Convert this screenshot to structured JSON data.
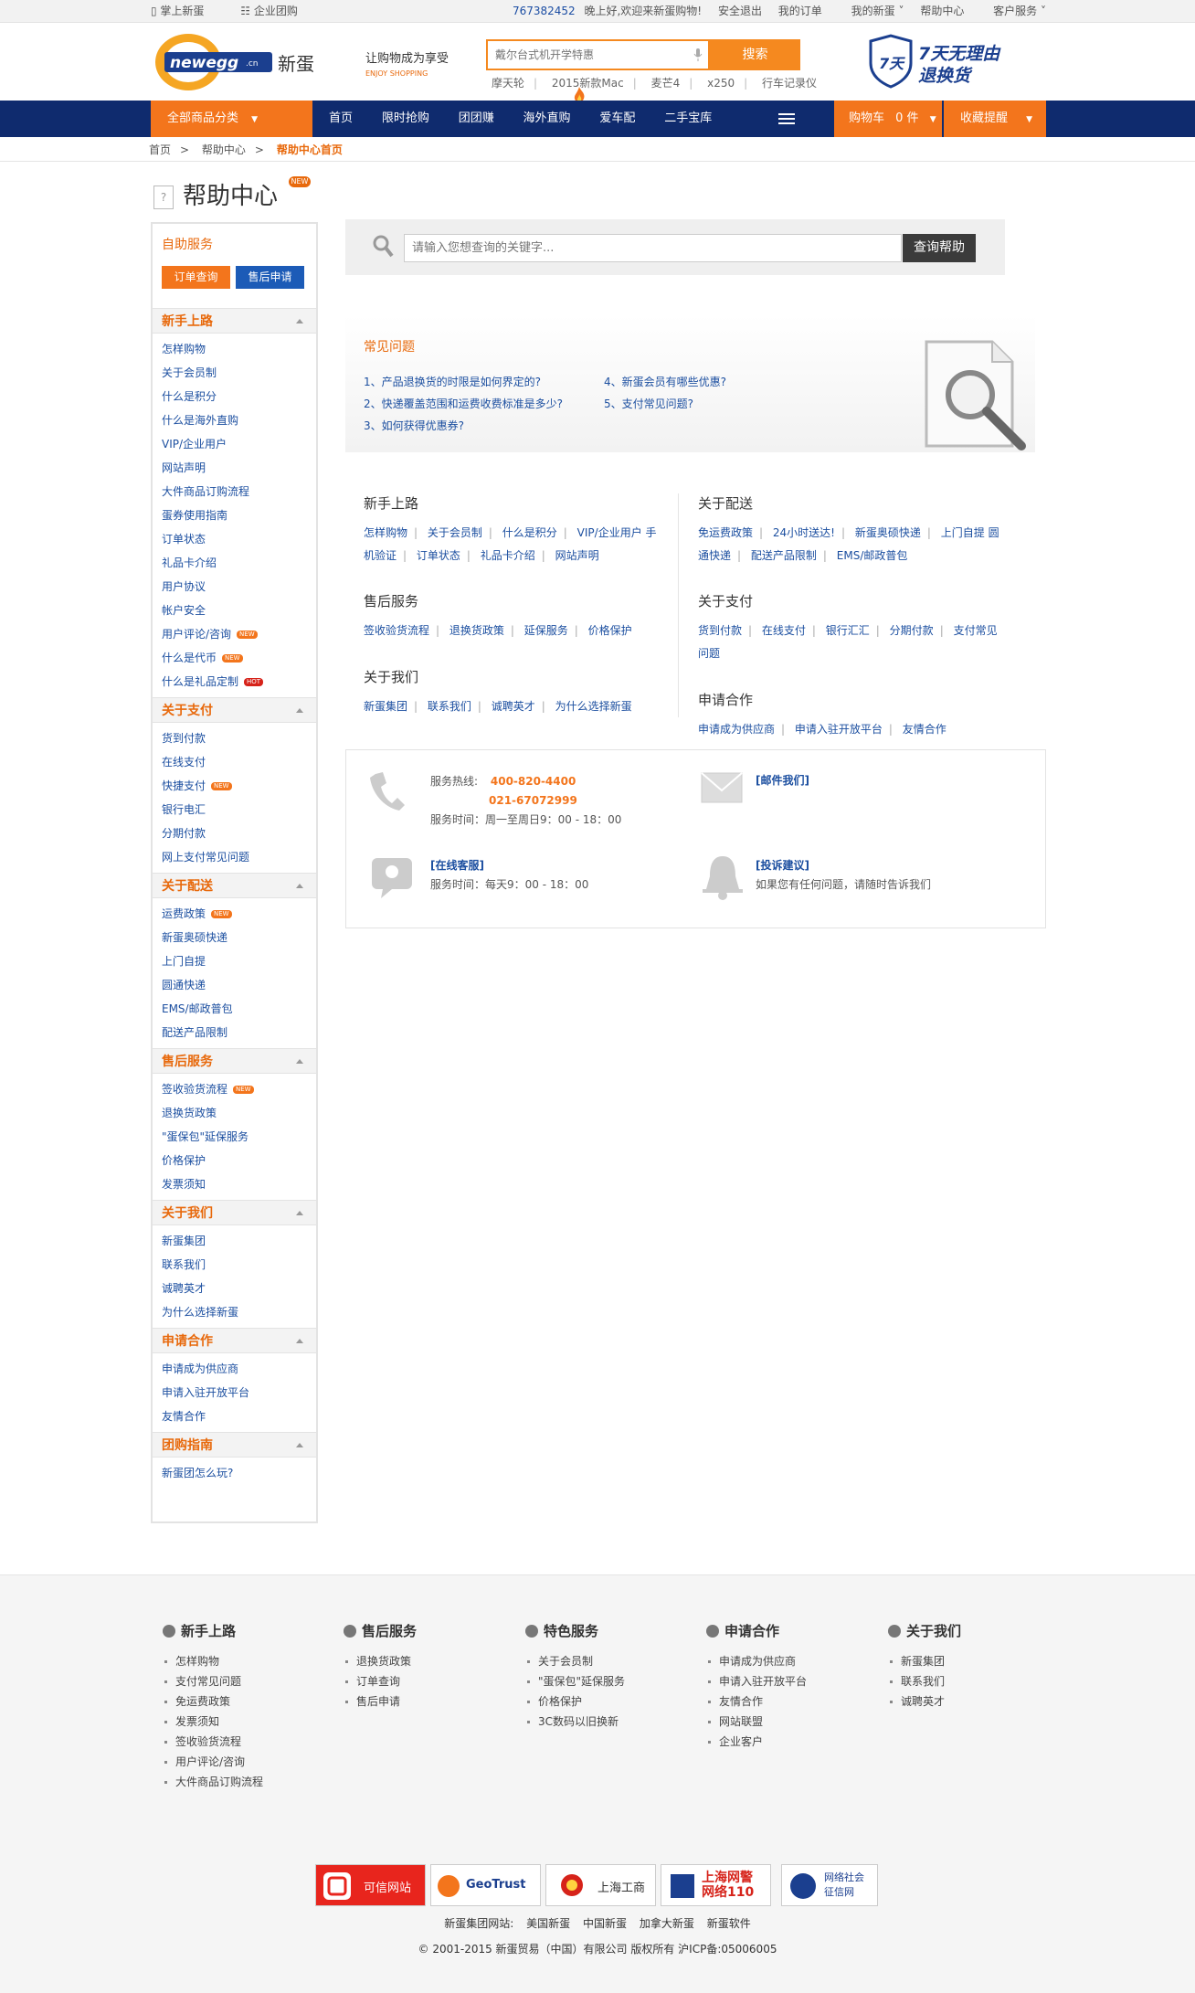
{
  "topbar": {
    "mobile": "掌上新蛋",
    "group": "企业团购",
    "phone": "767382452",
    "greeting": "晚上好,欢迎来新蛋购物!",
    "logout": "安全退出",
    "orders": "我的订单",
    "mynewegg": "我的新蛋",
    "help": "帮助中心",
    "service": "客户服务"
  },
  "header": {
    "logo_text": "newegg",
    "logo_suffix": ".cn",
    "brand_cn": "新蛋",
    "slogan": "让购物成为享受",
    "slogan_en": "ENJOY SHOPPING",
    "search_placeholder": "戴尔台式机开学特惠",
    "search_button": "搜索",
    "hotwords": [
      "摩天轮",
      "2015新款Mac",
      "麦芒4",
      "x250",
      "行车记录仪"
    ],
    "promise_days": "7天",
    "promise_line1": "7天无理由",
    "promise_line2": "退换货"
  },
  "nav": {
    "all": "全部商品分类",
    "items": [
      "首页",
      "限时抢购",
      "团团赚",
      "海外直购",
      "爱车配",
      "二手宝库"
    ],
    "cart": "购物车",
    "cart_count": "0 件",
    "favorites": "收藏提醒"
  },
  "breadcrumb": {
    "home": "首页",
    "help": "帮助中心",
    "current": "帮助中心首页"
  },
  "page_title": "帮助中心",
  "page_title_badge": "NEW",
  "sidebar": {
    "self_title": "自助服务",
    "order_btn": "订单查询",
    "aftersale_btn": "售后申请",
    "sections": [
      {
        "title": "新手上路",
        "items": [
          {
            "label": "怎样购物"
          },
          {
            "label": "关于会员制"
          },
          {
            "label": "什么是积分"
          },
          {
            "label": "什么是海外直购"
          },
          {
            "label": "VIP/企业用户"
          },
          {
            "label": "网站声明"
          },
          {
            "label": "大件商品订购流程"
          },
          {
            "label": "蛋券使用指南"
          },
          {
            "label": "订单状态"
          },
          {
            "label": "礼品卡介绍"
          },
          {
            "label": "用户协议"
          },
          {
            "label": "帐户安全"
          },
          {
            "label": "用户评论/咨询",
            "tag": "NEW"
          },
          {
            "label": "什么是代币",
            "tag": "NEW"
          },
          {
            "label": "什么是礼品定制",
            "tag": "HOT"
          }
        ]
      },
      {
        "title": "关于支付",
        "items": [
          {
            "label": "货到付款"
          },
          {
            "label": "在线支付"
          },
          {
            "label": "快捷支付",
            "tag": "NEW"
          },
          {
            "label": "银行电汇"
          },
          {
            "label": "分期付款"
          },
          {
            "label": "网上支付常见问题"
          }
        ]
      },
      {
        "title": "关于配送",
        "items": [
          {
            "label": "运费政策",
            "tag": "NEW"
          },
          {
            "label": "新蛋奥硕快递"
          },
          {
            "label": "上门自提"
          },
          {
            "label": "圆通快递"
          },
          {
            "label": "EMS/邮政普包"
          },
          {
            "label": "配送产品限制"
          }
        ]
      },
      {
        "title": "售后服务",
        "items": [
          {
            "label": "签收验货流程",
            "tag": "NEW"
          },
          {
            "label": "退换货政策"
          },
          {
            "label": "\"蛋保包\"延保服务"
          },
          {
            "label": "价格保护"
          },
          {
            "label": "发票须知"
          }
        ]
      },
      {
        "title": "关于我们",
        "items": [
          {
            "label": "新蛋集团"
          },
          {
            "label": "联系我们"
          },
          {
            "label": "诚聘英才"
          },
          {
            "label": "为什么选择新蛋"
          }
        ]
      },
      {
        "title": "申请合作",
        "items": [
          {
            "label": "申请成为供应商"
          },
          {
            "label": "申请入驻开放平台"
          },
          {
            "label": "友情合作"
          }
        ]
      },
      {
        "title": "团购指南",
        "items": [
          {
            "label": "新蛋团怎么玩?"
          }
        ]
      }
    ]
  },
  "main_search": {
    "placeholder": "请输入您想查询的关键字...",
    "button": "查询帮助"
  },
  "faq": {
    "title": "常见问题",
    "questions": [
      "1、产品退换货的时限是如何界定的?",
      "2、快递覆盖范围和运费收费标准是多少?",
      "3、如何获得优惠券?",
      "4、新蛋会员有哪些优惠?",
      "5、支付常见问题?"
    ]
  },
  "categories": {
    "newbie": {
      "title": "新手上路",
      "line1": [
        "怎样购物",
        "关于会员制",
        "什么是积分",
        "VIP/企业用户 手"
      ],
      "line2": [
        "机验证",
        "订单状态",
        "礼品卡介绍",
        "网站声明"
      ]
    },
    "aftersale": {
      "title": "售后服务",
      "line1": [
        "签收验货流程",
        "退换货政策",
        "延保服务",
        "价格保护"
      ]
    },
    "about": {
      "title": "关于我们",
      "line1": [
        "新蛋集团",
        "联系我们",
        "诚聘英才",
        "为什么选择新蛋"
      ]
    },
    "delivery": {
      "title": "关于配送",
      "line1": [
        "免运费政策",
        "24小时送达!",
        "新蛋奥硕快递",
        "上门自提 圆"
      ],
      "line2": [
        "通快递",
        "配送产品限制",
        "EMS/邮政普包"
      ]
    },
    "payment": {
      "title": "关于支付",
      "line1": [
        "货到付款",
        "在线支付",
        "银行汇汇",
        "分期付款",
        "支付常见"
      ],
      "line2": [
        "问题"
      ]
    },
    "coop": {
      "title": "申请合作",
      "line1": [
        "申请成为供应商",
        "申请入驻开放平台",
        "友情合作"
      ]
    }
  },
  "contact": {
    "hotline_label": "服务热线:",
    "hotline1": "400-820-4400",
    "hotline2": "021-67072999",
    "hotline_hours": "服务时间：周一至周日9：00 - 18：00",
    "email": "[邮件我们]",
    "online": "[在线客服]",
    "online_hours": "服务时间：每天9：00 - 18：00",
    "complaint": "[投诉建议]",
    "complaint_desc": "如果您有任何问题，请随时告诉我们"
  },
  "footer": {
    "cols": [
      {
        "title": "新手上路",
        "items": [
          "怎样购物",
          "支付常见问题",
          "免运费政策",
          "发票须知",
          "签收验货流程",
          "用户评论/咨询",
          "大件商品订购流程"
        ]
      },
      {
        "title": "售后服务",
        "items": [
          "退换货政策",
          "订单查询",
          "售后申请"
        ]
      },
      {
        "title": "特色服务",
        "items": [
          "关于会员制",
          "\"蛋保包\"延保服务",
          "价格保护",
          "3C数码以旧换新"
        ]
      },
      {
        "title": "申请合作",
        "items": [
          "申请成为供应商",
          "申请入驻开放平台",
          "友情合作",
          "网站联盟",
          "企业客户"
        ]
      },
      {
        "title": "关于我们",
        "items": [
          "新蛋集团",
          "联系我们",
          "诚聘英才"
        ]
      }
    ],
    "badges": [
      "可信网站",
      "GeoTrust",
      "上海工商",
      "上海网警 网络110",
      "网络社会 征信网"
    ],
    "links_label": "新蛋集团网站:",
    "links": [
      "美国新蛋",
      "中国新蛋",
      "加拿大新蛋",
      "新蛋软件"
    ],
    "copyright": "© 2001-2015  新蛋贸易（中国）有限公司  版权所有  沪ICP备:05006005"
  },
  "colors": {
    "orange": "#f3751c",
    "navy": "#0f2b6e",
    "link": "#1c4fa0"
  }
}
